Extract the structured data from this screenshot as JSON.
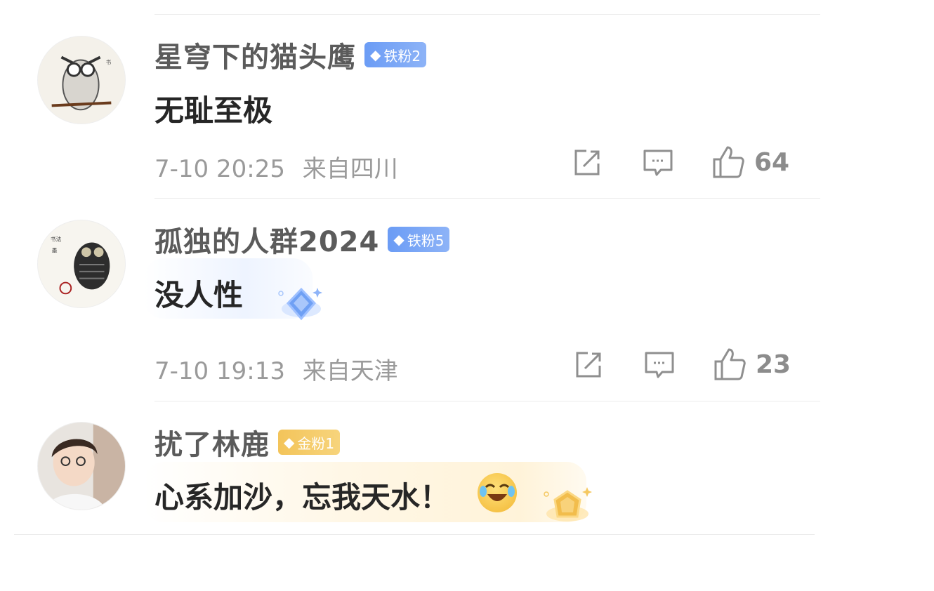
{
  "comments": [
    {
      "username": "星穹下的猫头鹰",
      "badge": {
        "label": "铁粉2",
        "color": "#7aa6f5"
      },
      "text": "无耻至极",
      "date": "7-10 20:25",
      "location": "来自四川",
      "likes": "64"
    },
    {
      "username": "孤独的人群2024",
      "badge": {
        "label": "铁粉5",
        "color": "#7aa6f5"
      },
      "text": "没人性",
      "date": "7-10 19:13",
      "location": "来自天津",
      "likes": "23"
    },
    {
      "username": "扰了林鹿",
      "badge": {
        "label": "金粉1",
        "color": "#f3c45a"
      },
      "text": "心系加沙，忘我天水！",
      "emoji": "laugh-cry-emoji"
    }
  ],
  "icons": {
    "share": "share-icon",
    "comment": "comment-icon",
    "like": "thumbs-up-icon",
    "badge": "diamond-icon"
  }
}
